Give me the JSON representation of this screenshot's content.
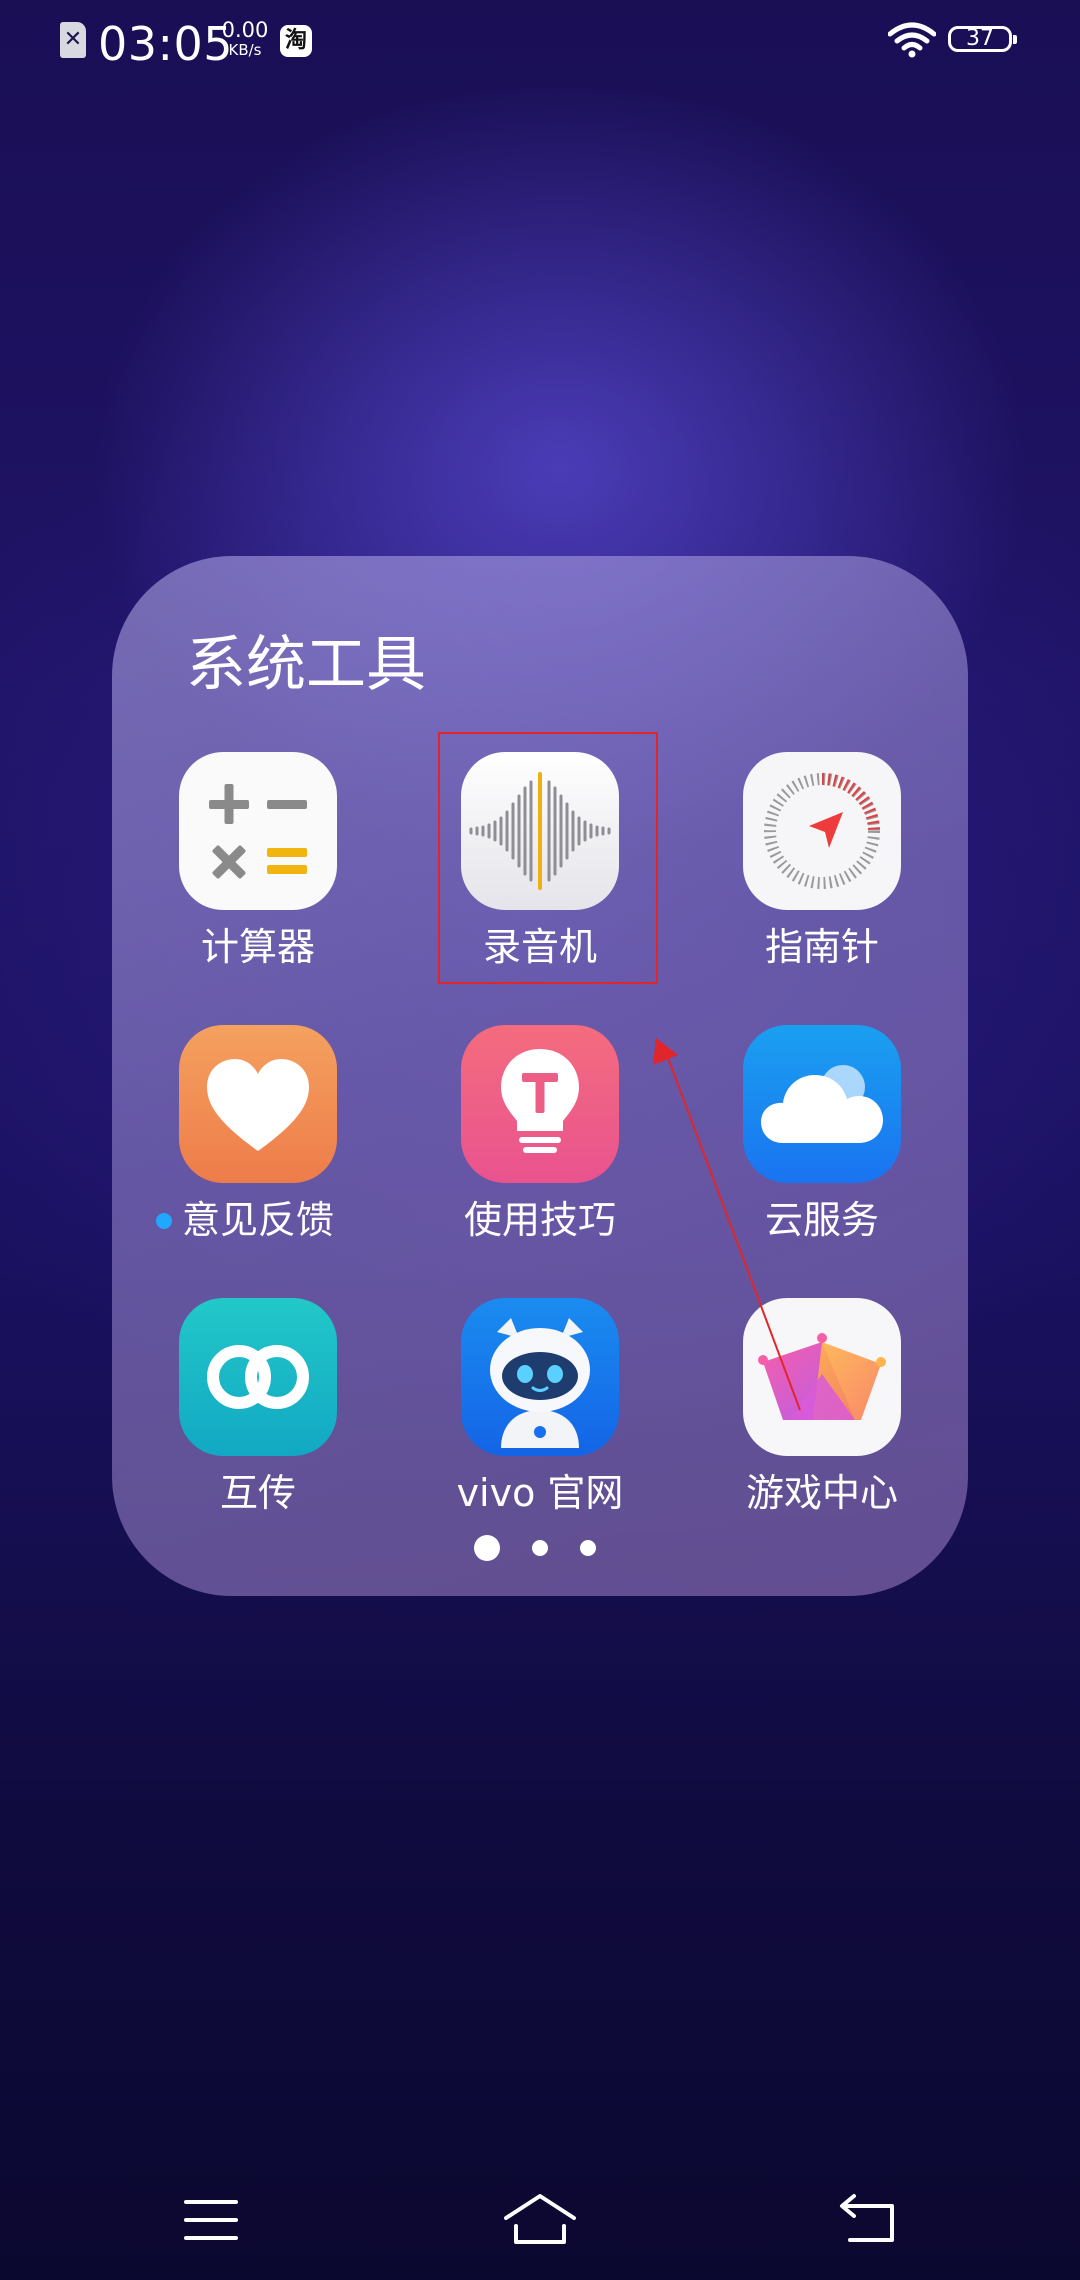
{
  "status_bar": {
    "time": "03:05",
    "net_speed_value": "0.00",
    "net_speed_unit": "KB/s",
    "taobao_glyph": "淘",
    "battery_level": "37",
    "icons": [
      "no-sim-icon",
      "taobao-notification-icon",
      "wifi-icon",
      "battery-icon"
    ]
  },
  "folder": {
    "title": "系统工具",
    "apps": [
      {
        "label": "计算器",
        "icon": "calculator-icon"
      },
      {
        "label": "录音机",
        "icon": "recorder-icon"
      },
      {
        "label": "指南针",
        "icon": "compass-icon"
      },
      {
        "label": "意见反馈",
        "icon": "feedback-heart-icon",
        "badge": true
      },
      {
        "label": "使用技巧",
        "icon": "tips-bulb-icon"
      },
      {
        "label": "云服务",
        "icon": "cloud-service-icon"
      },
      {
        "label": "互传",
        "icon": "easyshare-rings-icon"
      },
      {
        "label": "vivo 官网",
        "icon": "vivo-robot-icon"
      },
      {
        "label": "游戏中心",
        "icon": "game-center-crown-icon"
      }
    ],
    "page_count": 3,
    "current_page": 1
  },
  "nav_bar": {
    "icons": [
      "menu-icon",
      "home-icon",
      "back-icon"
    ]
  },
  "colors": {
    "annotation": "#e0262a",
    "badge": "#20a8ff"
  }
}
